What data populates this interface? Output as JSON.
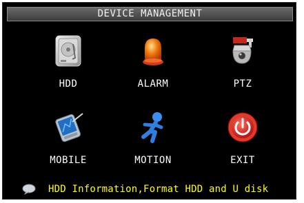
{
  "window": {
    "title": "DEVICE MANAGEMENT"
  },
  "menu": {
    "items": [
      {
        "label": "HDD",
        "icon": "hdd-icon"
      },
      {
        "label": "ALARM",
        "icon": "alarm-light-icon"
      },
      {
        "label": "PTZ",
        "icon": "ptz-camera-icon"
      },
      {
        "label": "MOBILE",
        "icon": "mobile-pda-icon"
      },
      {
        "label": "MOTION",
        "icon": "motion-person-icon"
      },
      {
        "label": "EXIT",
        "icon": "power-icon"
      }
    ]
  },
  "status": {
    "icon": "info-bubble-icon",
    "text": "HDD Information,Format HDD and U disk"
  },
  "colors": {
    "background": "#000000",
    "title_bar": "#4a4a4a",
    "label": "#ffffff",
    "status_text": "#ffff00"
  }
}
